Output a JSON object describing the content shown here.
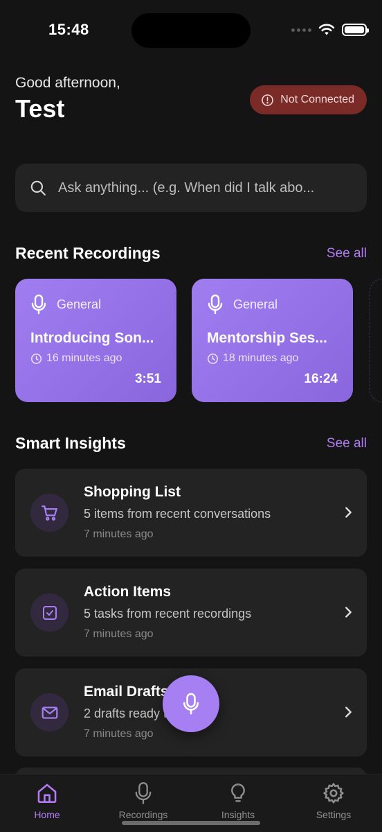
{
  "status_bar": {
    "time": "15:48"
  },
  "header": {
    "greeting": "Good afternoon,",
    "user_name": "Test",
    "connection_status": "Not Connected"
  },
  "search": {
    "placeholder": "Ask anything... (e.g. When did I talk abo..."
  },
  "recent_recordings": {
    "title": "Recent Recordings",
    "see_all": "See all",
    "items": [
      {
        "category": "General",
        "title": "Introducing Son...",
        "ago": "16 minutes ago",
        "duration": "3:51"
      },
      {
        "category": "General",
        "title": "Mentorship Ses...",
        "ago": "18 minutes ago",
        "duration": "16:24"
      }
    ]
  },
  "smart_insights": {
    "title": "Smart Insights",
    "see_all": "See all",
    "items": [
      {
        "icon": "cart-icon",
        "title": "Shopping List",
        "subtitle": "5 items from recent conversations",
        "time": "7 minutes ago"
      },
      {
        "icon": "checkbox-icon",
        "title": "Action Items",
        "subtitle": "5 tasks from recent recordings",
        "time": "7 minutes ago"
      },
      {
        "icon": "mail-icon",
        "title": "Email Drafts",
        "subtitle": "2 drafts ready to send",
        "time": "7 minutes ago"
      }
    ]
  },
  "tabs": [
    {
      "label": "Home",
      "icon": "home-icon",
      "active": true
    },
    {
      "label": "Recordings",
      "icon": "mic-icon",
      "active": false
    },
    {
      "label": "Insights",
      "icon": "lightbulb-icon",
      "active": false
    },
    {
      "label": "Settings",
      "icon": "gear-icon",
      "active": false
    }
  ],
  "colors": {
    "accent": "#b27cf5",
    "card_gradient_start": "#a07ef0",
    "card_gradient_end": "#8a66de",
    "badge_bg": "#7a2a27",
    "background": "#141414",
    "surface": "#232323"
  }
}
